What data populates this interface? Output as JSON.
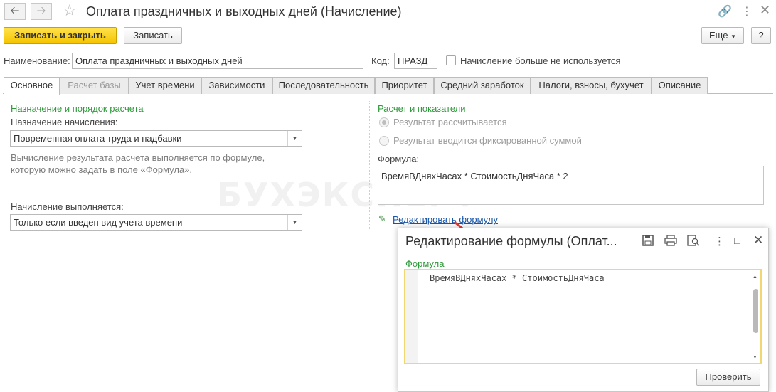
{
  "header": {
    "back_icon": "arrow-left-icon",
    "forward_icon": "arrow-right-icon",
    "favorite_icon": "star-icon",
    "title": "Оплата праздничных и выходных дней (Начисление)",
    "link_icon": "link-icon",
    "more_icon": "vertical-dots-icon",
    "close_icon": "close-icon"
  },
  "toolbar": {
    "save_close_label": "Записать и закрыть",
    "save_label": "Записать",
    "more_label": "Еще",
    "help_label": "?"
  },
  "form": {
    "name_label": "Наименование:",
    "name_value": "Оплата праздничных и выходных дней",
    "code_label": "Код:",
    "code_value": "ПРАЗД",
    "unused_label": "Начисление больше не используется",
    "unused_checked": false
  },
  "tabs": [
    {
      "label": "Основное",
      "active": true
    },
    {
      "label": "Расчет базы",
      "disabled": true
    },
    {
      "label": "Учет времени"
    },
    {
      "label": "Зависимости"
    },
    {
      "label": "Последовательность"
    },
    {
      "label": "Приоритет"
    },
    {
      "label": "Средний заработок"
    },
    {
      "label": "Налоги, взносы, бухучет"
    },
    {
      "label": "Описание"
    }
  ],
  "left": {
    "section_title": "Назначение и порядок расчета",
    "purpose_label": "Назначение начисления:",
    "purpose_value": "Повременная оплата труда и надбавки",
    "hint_line1": "Вычисление результата расчета выполняется по формуле,",
    "hint_line2": "которую можно задать в поле «Формула».",
    "exec_label": "Начисление выполняется:",
    "exec_value": "Только если введен вид учета времени"
  },
  "right": {
    "section_title": "Расчет и показатели",
    "radio_calculated": "Результат рассчитывается",
    "radio_fixed": "Результат вводится фиксированной суммой",
    "formula_label": "Формула:",
    "formula_value": "ВремяВДняхЧасах * СтоимостьДняЧаса * 2",
    "edit_link": "Редактировать формулу",
    "edit_icon": "pencil-icon"
  },
  "watermark": "БУХЭКСПЕРТ",
  "dialog": {
    "title": "Редактирование формулы (Оплат...",
    "save_icon": "floppy-disk-icon",
    "print_icon": "printer-icon",
    "preview_icon": "print-preview-icon",
    "more_icon": "vertical-dots-icon",
    "maximize_icon": "maximize-icon",
    "close_icon": "close-icon",
    "formula_label": "Формула",
    "formula_code": "ВремяВДняхЧасах * СтоимостьДняЧаса",
    "check_label": "Проверить"
  },
  "colors": {
    "accent_yellow": "#f5c400",
    "section_green": "#2f9a3b",
    "link_blue": "#1a56a8",
    "arrow_red": "#e53935"
  }
}
